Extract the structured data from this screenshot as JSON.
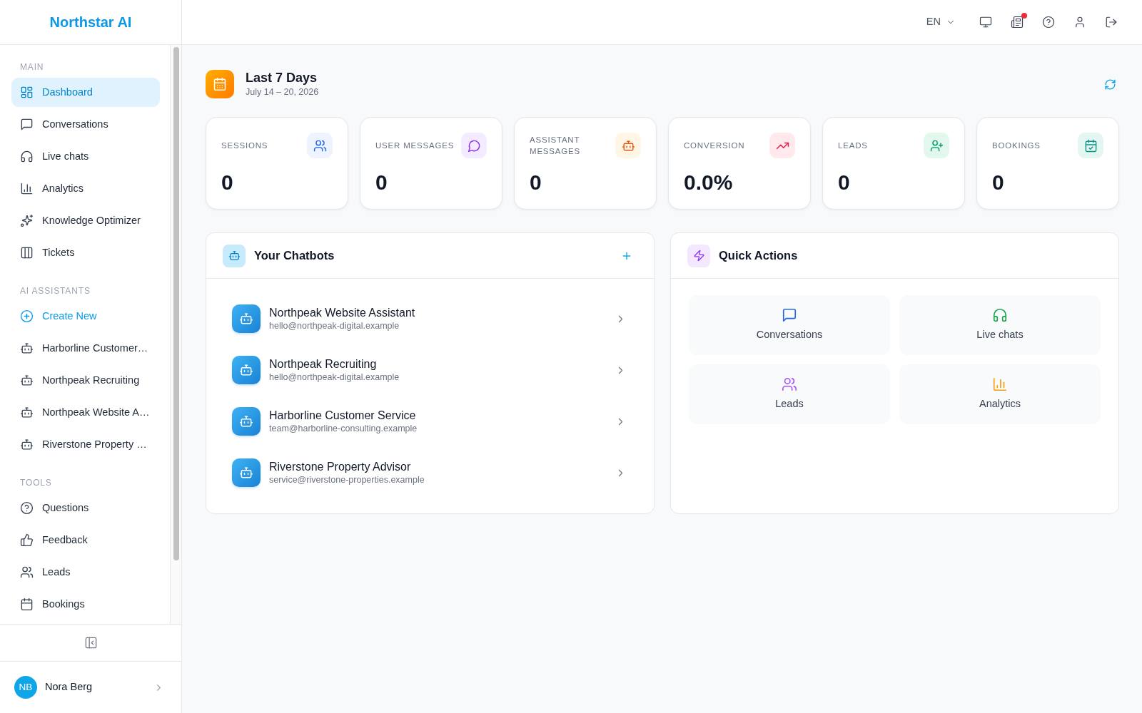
{
  "logo": "Northstar AI",
  "sidebar": {
    "sections": [
      {
        "title": "MAIN",
        "items": [
          {
            "label": "Dashboard",
            "selected": true
          },
          {
            "label": "Conversations",
            "selected": false
          },
          {
            "label": "Live chats",
            "selected": false
          },
          {
            "label": "Analytics",
            "selected": false
          },
          {
            "label": "Knowledge Optimizer",
            "selected": false
          },
          {
            "label": "Tickets",
            "selected": false
          }
        ]
      },
      {
        "title": "AI ASSISTANTS",
        "items": [
          {
            "kind": "create",
            "label": "Create New",
            "selected": false
          },
          {
            "kind": "assistant",
            "label": "Harborline Customer…",
            "selected": false
          },
          {
            "kind": "assistant",
            "label": "Northpeak Recruiting",
            "selected": false
          },
          {
            "kind": "assistant",
            "label": "Northpeak Website A…",
            "selected": false
          },
          {
            "kind": "assistant",
            "label": "Riverstone Property …",
            "selected": false
          }
        ]
      },
      {
        "title": "TOOLS",
        "items": [
          {
            "label": "Questions",
            "selected": false
          },
          {
            "label": "Feedback",
            "selected": false
          },
          {
            "label": "Leads",
            "selected": false
          },
          {
            "label": "Bookings",
            "selected": false
          }
        ]
      }
    ],
    "user": {
      "initials": "NB",
      "name": "Nora Berg"
    }
  },
  "header": {
    "language": "EN",
    "news_unread": true
  },
  "period": {
    "title": "Last 7 Days",
    "range": "July 14 – 20, 2026"
  },
  "stats": [
    {
      "label": "SESSIONS",
      "value": "0"
    },
    {
      "label": "USER MESSAGES",
      "value": "0"
    },
    {
      "label": "ASSISTANT MESSAGES",
      "value": "0"
    },
    {
      "label": "CONVERSION",
      "value": "0.0%"
    },
    {
      "label": "LEADS",
      "value": "0"
    },
    {
      "label": "BOOKINGS",
      "value": "0"
    }
  ],
  "chatbots": {
    "title": "Your Chatbots",
    "items": [
      {
        "name": "Northpeak Website Assistant",
        "email": "hello@northpeak-digital.example"
      },
      {
        "name": "Northpeak Recruiting",
        "email": "hello@northpeak-digital.example"
      },
      {
        "name": "Harborline Customer Service",
        "email": "team@harborline-consulting.example"
      },
      {
        "name": "Riverstone Property Advisor",
        "email": "service@riverstone-properties.example"
      }
    ]
  },
  "quick_actions": {
    "title": "Quick Actions",
    "items": [
      {
        "label": "Conversations"
      },
      {
        "label": "Live chats"
      },
      {
        "label": "Leads"
      },
      {
        "label": "Analytics"
      }
    ]
  }
}
